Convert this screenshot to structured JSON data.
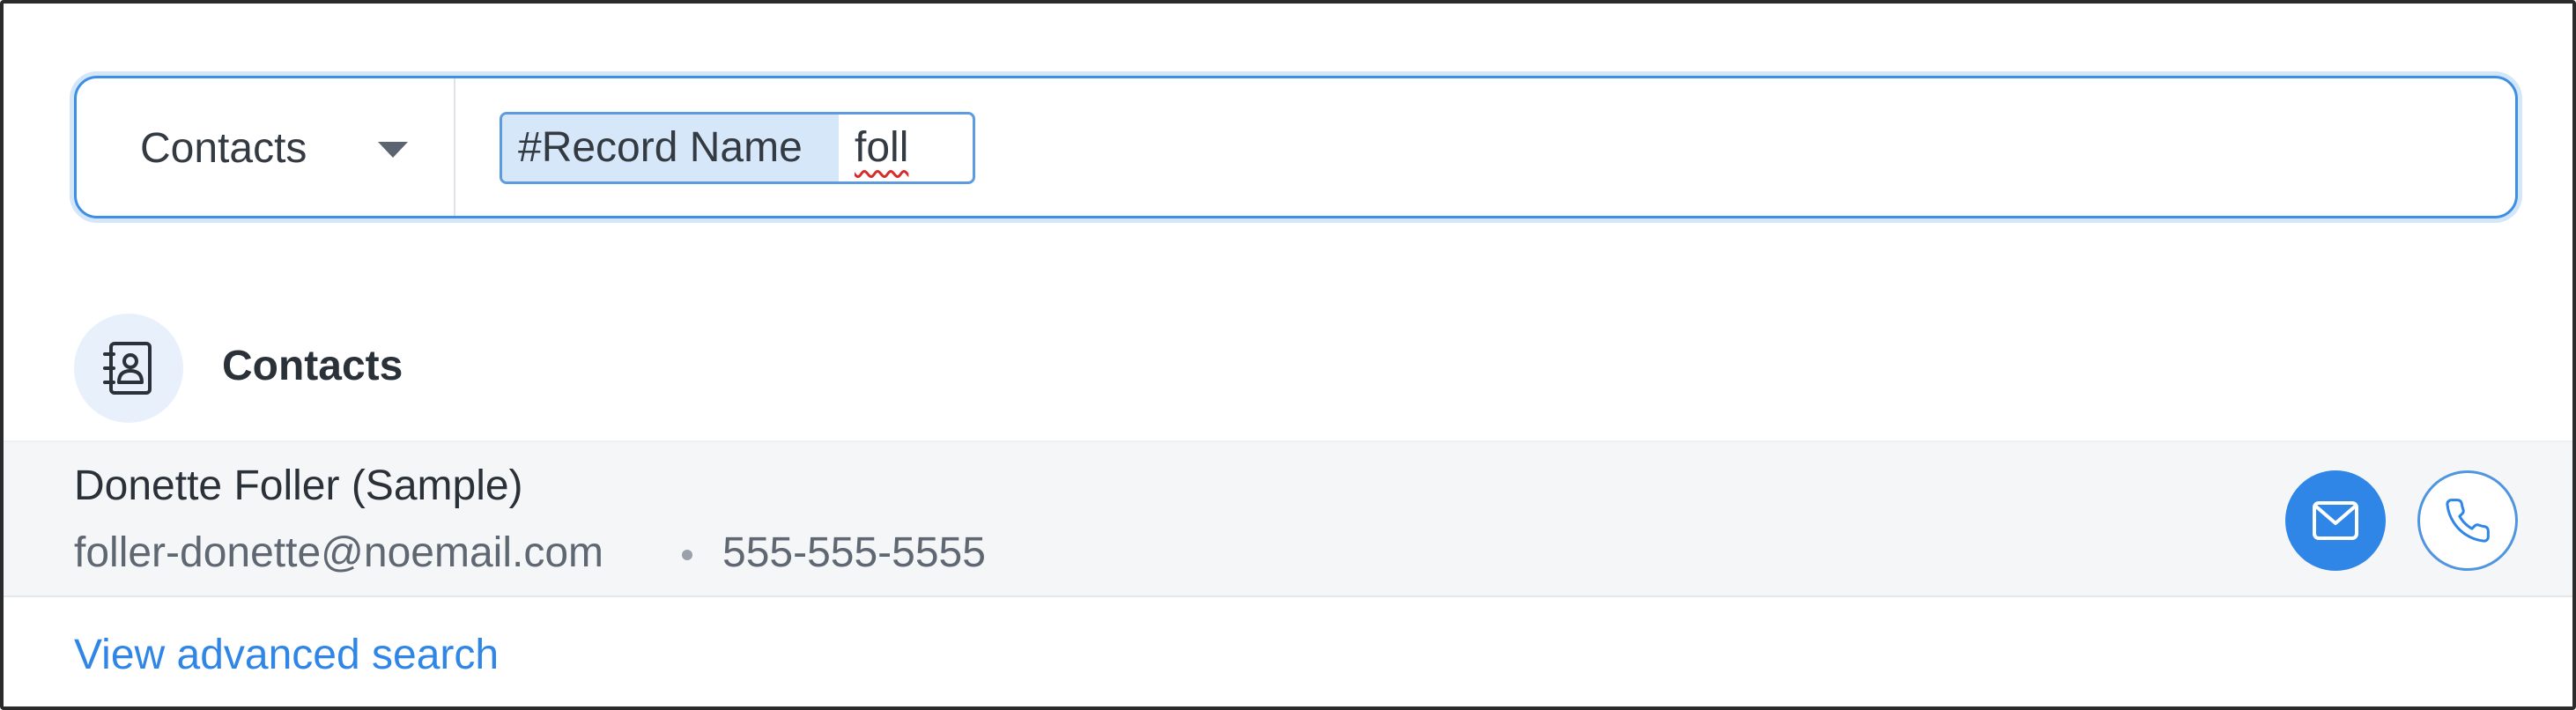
{
  "search": {
    "module": "Contacts",
    "chip_key": "#Record Name",
    "chip_value": "foll"
  },
  "results": {
    "module_title": "Contacts",
    "module_icon": "contact-card-icon",
    "items": [
      {
        "name": "Donette Foller (Sample)",
        "email": "foller-donette@noemail.com",
        "phone": "555-555-5555",
        "email_icon": "envelope-icon",
        "call_icon": "phone-icon"
      }
    ]
  },
  "footer": {
    "advanced_search_label": "View advanced search"
  },
  "colors": {
    "accent": "#2f86e6",
    "chip_bg": "#d6e7f9",
    "row_bg": "#f4f6f8"
  }
}
